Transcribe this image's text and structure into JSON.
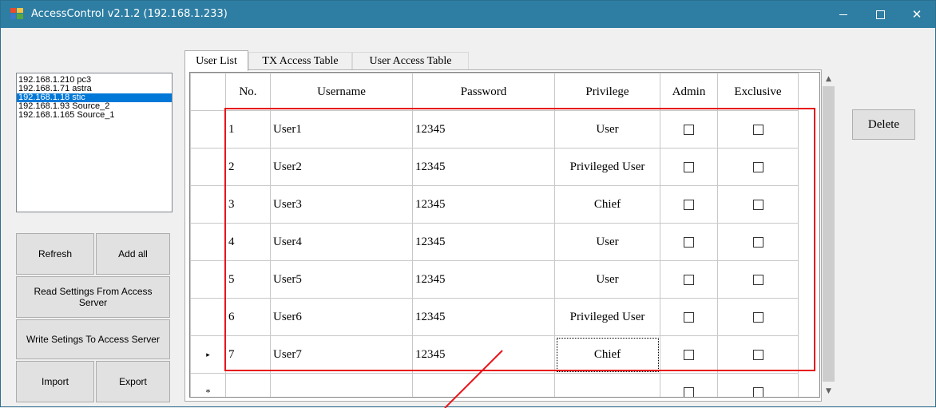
{
  "window": {
    "title": "AccessControl v2.1.2 (192.168.1.233)"
  },
  "hosts": [
    {
      "label": "192.168.1.210 pc3",
      "selected": false
    },
    {
      "label": "192.168.1.71 astra",
      "selected": false
    },
    {
      "label": "192.168.1.18 stic",
      "selected": true
    },
    {
      "label": "192.168.1.93 Source_2",
      "selected": false
    },
    {
      "label": "192.168.1.165 Source_1",
      "selected": false
    }
  ],
  "buttons": {
    "refresh": "Refresh",
    "add_all": "Add all",
    "read_settings": "Read Settings From Access Server",
    "write_settings": "Write Setings To Access Server",
    "import": "Import",
    "export": "Export",
    "delete": "Delete"
  },
  "tabs": [
    {
      "label": "User List",
      "active": true
    },
    {
      "label": "TX Access Table",
      "active": false
    },
    {
      "label": "User Access Table",
      "active": false
    }
  ],
  "grid": {
    "columns": [
      "No.",
      "Username",
      "Password",
      "Privilege",
      "Admin",
      "Exclusive"
    ],
    "rows": [
      {
        "no": "1",
        "username": "User1",
        "password": "12345",
        "privilege": "User",
        "admin": false,
        "exclusive": false
      },
      {
        "no": "2",
        "username": "User2",
        "password": "12345",
        "privilege": "Privileged User",
        "admin": false,
        "exclusive": false
      },
      {
        "no": "3",
        "username": "User3",
        "password": "12345",
        "privilege": "Chief",
        "admin": false,
        "exclusive": false
      },
      {
        "no": "4",
        "username": "User4",
        "password": "12345",
        "privilege": "User",
        "admin": false,
        "exclusive": false
      },
      {
        "no": "5",
        "username": "User5",
        "password": "12345",
        "privilege": "User",
        "admin": false,
        "exclusive": false
      },
      {
        "no": "6",
        "username": "User6",
        "password": "12345",
        "privilege": "Privileged User",
        "admin": false,
        "exclusive": false
      },
      {
        "no": "7",
        "username": "User7",
        "password": "12345",
        "privilege": "Chief",
        "admin": false,
        "exclusive": false
      }
    ],
    "current_row_marker": "▸",
    "new_row_marker": "*"
  },
  "colors": {
    "titlebar": "#2e7ea3",
    "selection": "#0078d7",
    "annotation": "#e8141a"
  }
}
